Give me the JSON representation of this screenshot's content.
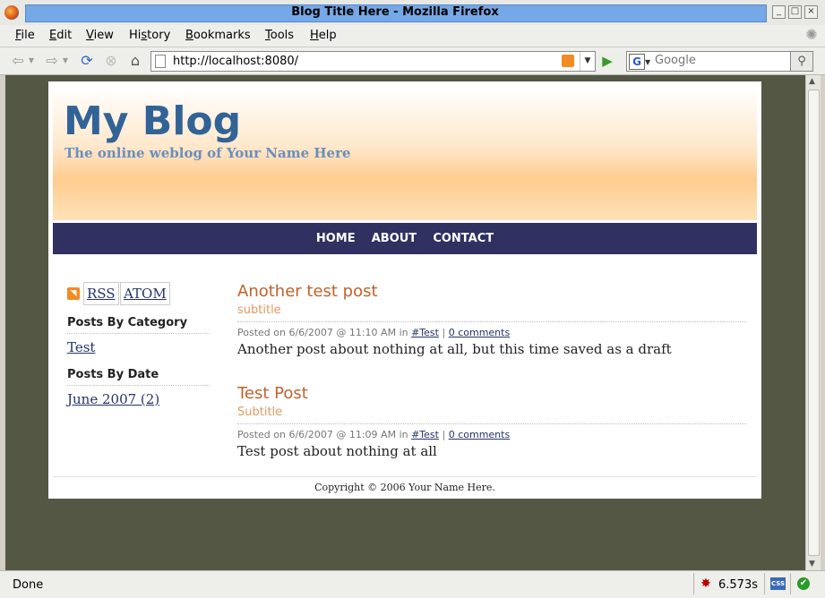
{
  "window": {
    "title": "Blog Title Here - Mozilla Firefox"
  },
  "menu": [
    {
      "prefix": "",
      "key": "F",
      "rest": "ile"
    },
    {
      "prefix": "",
      "key": "E",
      "rest": "dit"
    },
    {
      "prefix": "",
      "key": "V",
      "rest": "iew"
    },
    {
      "prefix": "Hi",
      "key": "s",
      "rest": "tory"
    },
    {
      "prefix": "",
      "key": "B",
      "rest": "ookmarks"
    },
    {
      "prefix": "",
      "key": "T",
      "rest": "ools"
    },
    {
      "prefix": "",
      "key": "H",
      "rest": "elp"
    }
  ],
  "navbar": {
    "url": "http://localhost:8080/",
    "search_placeholder": "Google",
    "search_engine_letter": "G"
  },
  "blog": {
    "title": "My Blog",
    "subtitle": "The online weblog of Your Name Here",
    "nav": [
      "HOME",
      "ABOUT",
      "CONTACT"
    ],
    "feeds": {
      "rss": "RSS",
      "atom": "ATOM"
    },
    "sidebar": {
      "category_heading": "Posts By Category",
      "categories": [
        "Test"
      ],
      "date_heading": "Posts By Date",
      "dates": [
        "June 2007 (2)"
      ]
    },
    "posts": [
      {
        "title": "Another test post",
        "subtitle": "subtitle",
        "meta_prefix": "Posted on 6/6/2007 @ 11:10 AM in",
        "tag": "#Test",
        "comments": "0 comments",
        "body": "Another post about nothing at all, but this time saved as a draft"
      },
      {
        "title": "Test Post",
        "subtitle": "Subtitle",
        "meta_prefix": "Posted on 6/6/2007 @ 11:09 AM in",
        "tag": "#Test",
        "comments": "0 comments",
        "body": "Test post about nothing at all"
      }
    ],
    "footer": "Copyright © 2006 Your Name Here."
  },
  "status": {
    "text": "Done",
    "timing": "6.573s",
    "css_badge": "CSS"
  },
  "colors": {
    "blog_title": "#326396",
    "nav_bg": "#303061",
    "post_title": "#c0622c",
    "post_subtitle": "#e09a62",
    "viewport_bg": "#555745",
    "title_bar": "#75a8e6"
  }
}
